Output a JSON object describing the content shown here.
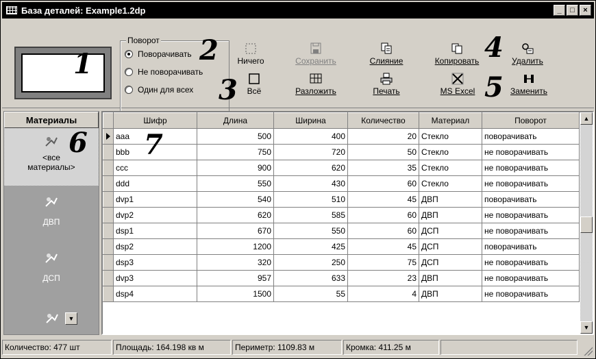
{
  "window": {
    "title": "База деталей: Example1.2dp",
    "buttons": {
      "minimize": "_",
      "maximize": "□",
      "close": "×"
    }
  },
  "rotation_group": {
    "legend": "Поворот",
    "options": [
      "Поворачивать",
      "Не поворачивать",
      "Один для всех"
    ],
    "selected": "Поворачивать"
  },
  "toolbar": {
    "nothing_label": "Ничего",
    "all_label": "Всё",
    "save_label": "Сохранить",
    "arrange_label": "Разложить",
    "merge_label": "Слияние",
    "print_label": "Печать",
    "copy_label": "Копировать",
    "excel_label": "MS Excel",
    "delete_label": "Удалить",
    "replace_label": "Заменить"
  },
  "callouts": [
    "1",
    "2",
    "3",
    "4",
    "5",
    "6",
    "7"
  ],
  "materials_panel": {
    "header": "Материалы",
    "items": [
      "<все материалы>",
      "ДВП",
      "ДСП"
    ]
  },
  "grid": {
    "columns": [
      "Шифр",
      "Длина",
      "Ширина",
      "Количество",
      "Материал",
      "Поворот"
    ],
    "rows": [
      [
        "aaa",
        "500",
        "400",
        "20",
        "Стекло",
        "поворачивать"
      ],
      [
        "bbb",
        "750",
        "720",
        "50",
        "Стекло",
        "не поворачивать"
      ],
      [
        "ccc",
        "900",
        "620",
        "35",
        "Стекло",
        "не поворачивать"
      ],
      [
        "ddd",
        "550",
        "430",
        "60",
        "Стекло",
        "не поворачивать"
      ],
      [
        "dvp1",
        "540",
        "510",
        "45",
        "ДВП",
        "поворачивать"
      ],
      [
        "dvp2",
        "620",
        "585",
        "60",
        "ДВП",
        "не поворачивать"
      ],
      [
        "dsp1",
        "670",
        "550",
        "60",
        "ДСП",
        "не поворачивать"
      ],
      [
        "dsp2",
        "1200",
        "425",
        "45",
        "ДСП",
        "поворачивать"
      ],
      [
        "dsp3",
        "320",
        "250",
        "75",
        "ДСП",
        "не поворачивать"
      ],
      [
        "dvp3",
        "957",
        "633",
        "23",
        "ДВП",
        "не поворачивать"
      ],
      [
        "dsp4",
        "1500",
        "55",
        "4",
        "ДВП",
        "не поворачивать"
      ]
    ]
  },
  "status": {
    "count": "Количество: 477 шт",
    "area": "Площадь: 164.198 кв м",
    "perimeter": "Периметр: 1109.83 м",
    "edge": "Кромка: 411.25 м"
  },
  "icons": {
    "app": "grid-icon",
    "nothing": "dashed-square-icon",
    "all": "square-icon",
    "save": "floppy-icon",
    "arrange": "layout-grid-icon",
    "merge": "merge-icon",
    "print": "printer-icon",
    "copy": "copy-icon",
    "excel": "excel-icon",
    "delete": "delete-icon",
    "replace": "replace-icon",
    "material": "material-icon"
  }
}
